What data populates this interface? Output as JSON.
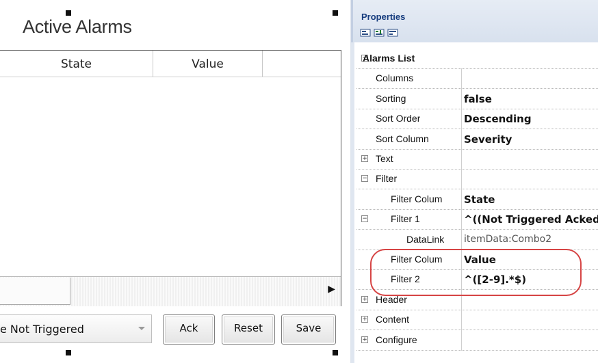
{
  "designer": {
    "title": "Active Alarms",
    "columns": [
      "State",
      "Value"
    ],
    "filter_combo_value": "e Not Triggered",
    "buttons": {
      "ack": "Ack",
      "reset": "Reset",
      "save": "Save"
    }
  },
  "properties": {
    "title": "Properties",
    "toolbar_icons": [
      "categorized-icon",
      "sorted-icon",
      "property-pages-icon"
    ],
    "rows": [
      {
        "name": "Alarms List",
        "value": "",
        "expander": "minus",
        "bold_name": true
      },
      {
        "name": "Columns",
        "value": "",
        "expander": ""
      },
      {
        "name": "Sorting",
        "value": "false",
        "expander": ""
      },
      {
        "name": "Sort Order",
        "value": "Descending",
        "expander": ""
      },
      {
        "name": "Sort Column",
        "value": "Severity",
        "expander": ""
      },
      {
        "name": "Text",
        "value": "",
        "expander": "plus"
      },
      {
        "name": "Filter",
        "value": "",
        "expander": "minus"
      },
      {
        "name": "Filter Colum",
        "value": "State",
        "expander": ""
      },
      {
        "name": "Filter 1",
        "value": "^((Not Triggered Acked",
        "expander": "minus"
      },
      {
        "name": "DataLink",
        "value": "itemData:Combo2",
        "expander": "",
        "light": true
      },
      {
        "name": "Filter Colum",
        "value": "Value",
        "expander": ""
      },
      {
        "name": "Filter 2",
        "value": "^([2-9].*$)",
        "expander": ""
      },
      {
        "name": "Header",
        "value": "",
        "expander": "plus"
      },
      {
        "name": "Content",
        "value": "",
        "expander": "plus"
      },
      {
        "name": "Configure",
        "value": "",
        "expander": "plus"
      }
    ]
  },
  "accent_colors": {
    "highlight": "#d64444",
    "panel_title": "#163c7e"
  }
}
